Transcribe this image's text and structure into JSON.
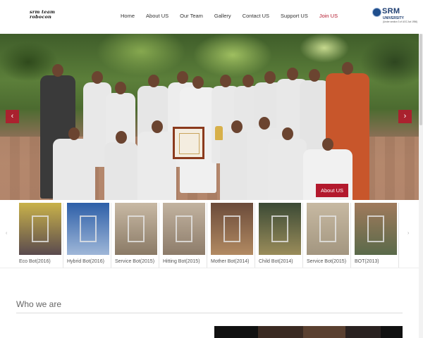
{
  "header": {
    "logo_alt": "srm team robocon",
    "logo_lines": [
      "srm team",
      "robocon"
    ],
    "nav": [
      {
        "label": "Home",
        "active": false
      },
      {
        "label": "About US",
        "active": false
      },
      {
        "label": "Our Team",
        "active": false
      },
      {
        "label": "Gallery",
        "active": false
      },
      {
        "label": "Contact US",
        "active": false
      },
      {
        "label": "Support US",
        "active": false
      },
      {
        "label": "Join US",
        "active": true
      }
    ],
    "university_logo": {
      "name": "SRM",
      "sub": "UNIVERSITY",
      "tag": "(Under section 3 of UGC Act 1956)"
    }
  },
  "hero": {
    "prev_icon": "chevron-left-icon",
    "next_icon": "chevron-right-icon",
    "prev_symbol": "‹",
    "next_symbol": "›",
    "button_label": "About US"
  },
  "gallery": {
    "prev_symbol": "‹",
    "next_symbol": "›",
    "items": [
      {
        "label": "Eco Bot(2016)"
      },
      {
        "label": "Hybrid Bot(2016)"
      },
      {
        "label": "Service Bot(2015)"
      },
      {
        "label": "Hitting Bot(2015)"
      },
      {
        "label": "Mother Bot(2014)"
      },
      {
        "label": "Child Bot(2014)"
      },
      {
        "label": "Service Bot(2015)"
      },
      {
        "label": "BOT(2013)"
      }
    ]
  },
  "section": {
    "title": "Who we are"
  },
  "colors": {
    "accent": "#b3192d",
    "nav_text": "#333333",
    "brand_blue": "#1f3f72"
  }
}
